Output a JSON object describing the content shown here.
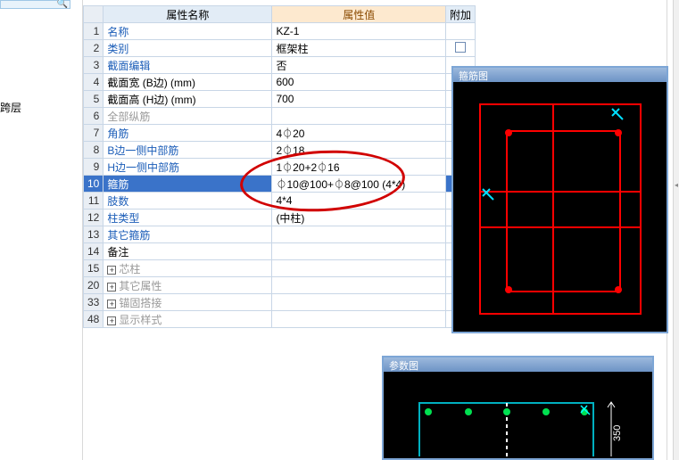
{
  "left_label": "跨层",
  "headers": {
    "name": "属性名称",
    "value": "属性值",
    "extra": "附加"
  },
  "panels": {
    "stirrup": "箍筋图",
    "param": "参数图",
    "param_dim": "350"
  },
  "rows": [
    {
      "num": "1",
      "name": "名称",
      "value": "KZ-1",
      "link": true,
      "gray": false,
      "expand": false,
      "selected": false,
      "chk": false
    },
    {
      "num": "2",
      "name": "类别",
      "value": "框架柱",
      "link": true,
      "gray": false,
      "expand": false,
      "selected": false,
      "chk": true
    },
    {
      "num": "3",
      "name": "截面编辑",
      "value": "否",
      "link": true,
      "gray": false,
      "expand": false,
      "selected": false,
      "chk": false
    },
    {
      "num": "4",
      "name": "截面宽 (B边) (mm)",
      "value": "600",
      "link": false,
      "gray": false,
      "expand": false,
      "selected": false,
      "chk": false
    },
    {
      "num": "5",
      "name": "截面高 (H边) (mm)",
      "value": "700",
      "link": false,
      "gray": false,
      "expand": false,
      "selected": false,
      "chk": false
    },
    {
      "num": "6",
      "name": "全部纵筋",
      "value": "",
      "link": false,
      "gray": true,
      "expand": false,
      "selected": false,
      "chk": false
    },
    {
      "num": "7",
      "name": "角筋",
      "value": "4⏀20",
      "link": true,
      "gray": false,
      "expand": false,
      "selected": false,
      "chk": false
    },
    {
      "num": "8",
      "name": "B边一侧中部筋",
      "value": "2⏀18",
      "link": true,
      "gray": false,
      "expand": false,
      "selected": false,
      "chk": false
    },
    {
      "num": "9",
      "name": "H边一侧中部筋",
      "value": "1⏀20+2⏀16",
      "link": true,
      "gray": false,
      "expand": false,
      "selected": false,
      "chk": false
    },
    {
      "num": "10",
      "name": "箍筋",
      "value": "⏀10@100+⏀8@100 (4*4)",
      "link": true,
      "gray": false,
      "expand": false,
      "selected": true,
      "chk": false
    },
    {
      "num": "11",
      "name": "肢数",
      "value": "4*4",
      "link": true,
      "gray": false,
      "expand": false,
      "selected": false,
      "chk": false
    },
    {
      "num": "12",
      "name": "柱类型",
      "value": "(中柱)",
      "link": true,
      "gray": false,
      "expand": false,
      "selected": false,
      "chk": false
    },
    {
      "num": "13",
      "name": "其它箍筋",
      "value": "",
      "link": true,
      "gray": false,
      "expand": false,
      "selected": false,
      "chk": false
    },
    {
      "num": "14",
      "name": "备注",
      "value": "",
      "link": false,
      "gray": false,
      "expand": false,
      "selected": false,
      "chk": false
    },
    {
      "num": "15",
      "name": "芯柱",
      "value": "",
      "link": false,
      "gray": true,
      "expand": true,
      "selected": false,
      "chk": false
    },
    {
      "num": "20",
      "name": "其它属性",
      "value": "",
      "link": false,
      "gray": true,
      "expand": true,
      "selected": false,
      "chk": false
    },
    {
      "num": "33",
      "name": "锚固搭接",
      "value": "",
      "link": false,
      "gray": true,
      "expand": true,
      "selected": false,
      "chk": false
    },
    {
      "num": "48",
      "name": "显示样式",
      "value": "",
      "link": false,
      "gray": true,
      "expand": true,
      "selected": false,
      "chk": false
    }
  ]
}
